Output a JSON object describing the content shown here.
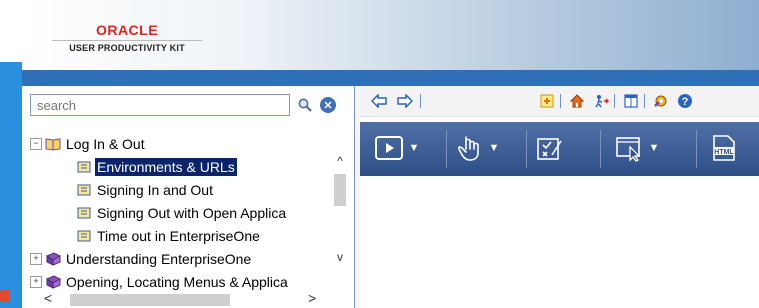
{
  "brand": {
    "name": "ORACLE",
    "product": "USER PRODUCTIVITY KIT"
  },
  "search": {
    "placeholder": "search",
    "value": ""
  },
  "tree": {
    "items": [
      {
        "label": "Log In & Out",
        "type": "book-open",
        "expanded": true
      },
      {
        "label": "Environments & URLs",
        "type": "topic",
        "selected": true
      },
      {
        "label": "Signing In and Out",
        "type": "topic"
      },
      {
        "label": "Signing Out with Open Applica",
        "type": "topic"
      },
      {
        "label": "Time out in EnterpriseOne",
        "type": "topic"
      },
      {
        "label": "Understanding EnterpriseOne",
        "type": "book-closed",
        "expanded": false
      },
      {
        "label": "Opening, Locating Menus & Applica",
        "type": "book-closed",
        "expanded": false
      }
    ]
  },
  "toolbar_top": {
    "icons": [
      "back-arrow-icon",
      "forward-arrow-icon",
      "new-document-icon",
      "home-icon",
      "exit-icon",
      "window-icon",
      "preferences-icon",
      "help-icon"
    ]
  },
  "toolbar_modes": {
    "icons": [
      "play-icon",
      "hand-pointer-icon",
      "checklist-icon",
      "screen-pointer-icon",
      "html-icon"
    ]
  },
  "colors": {
    "oracle_red": "#e2231a",
    "selection": "#0a246a",
    "toolbar_blue": "#2e4f86"
  }
}
